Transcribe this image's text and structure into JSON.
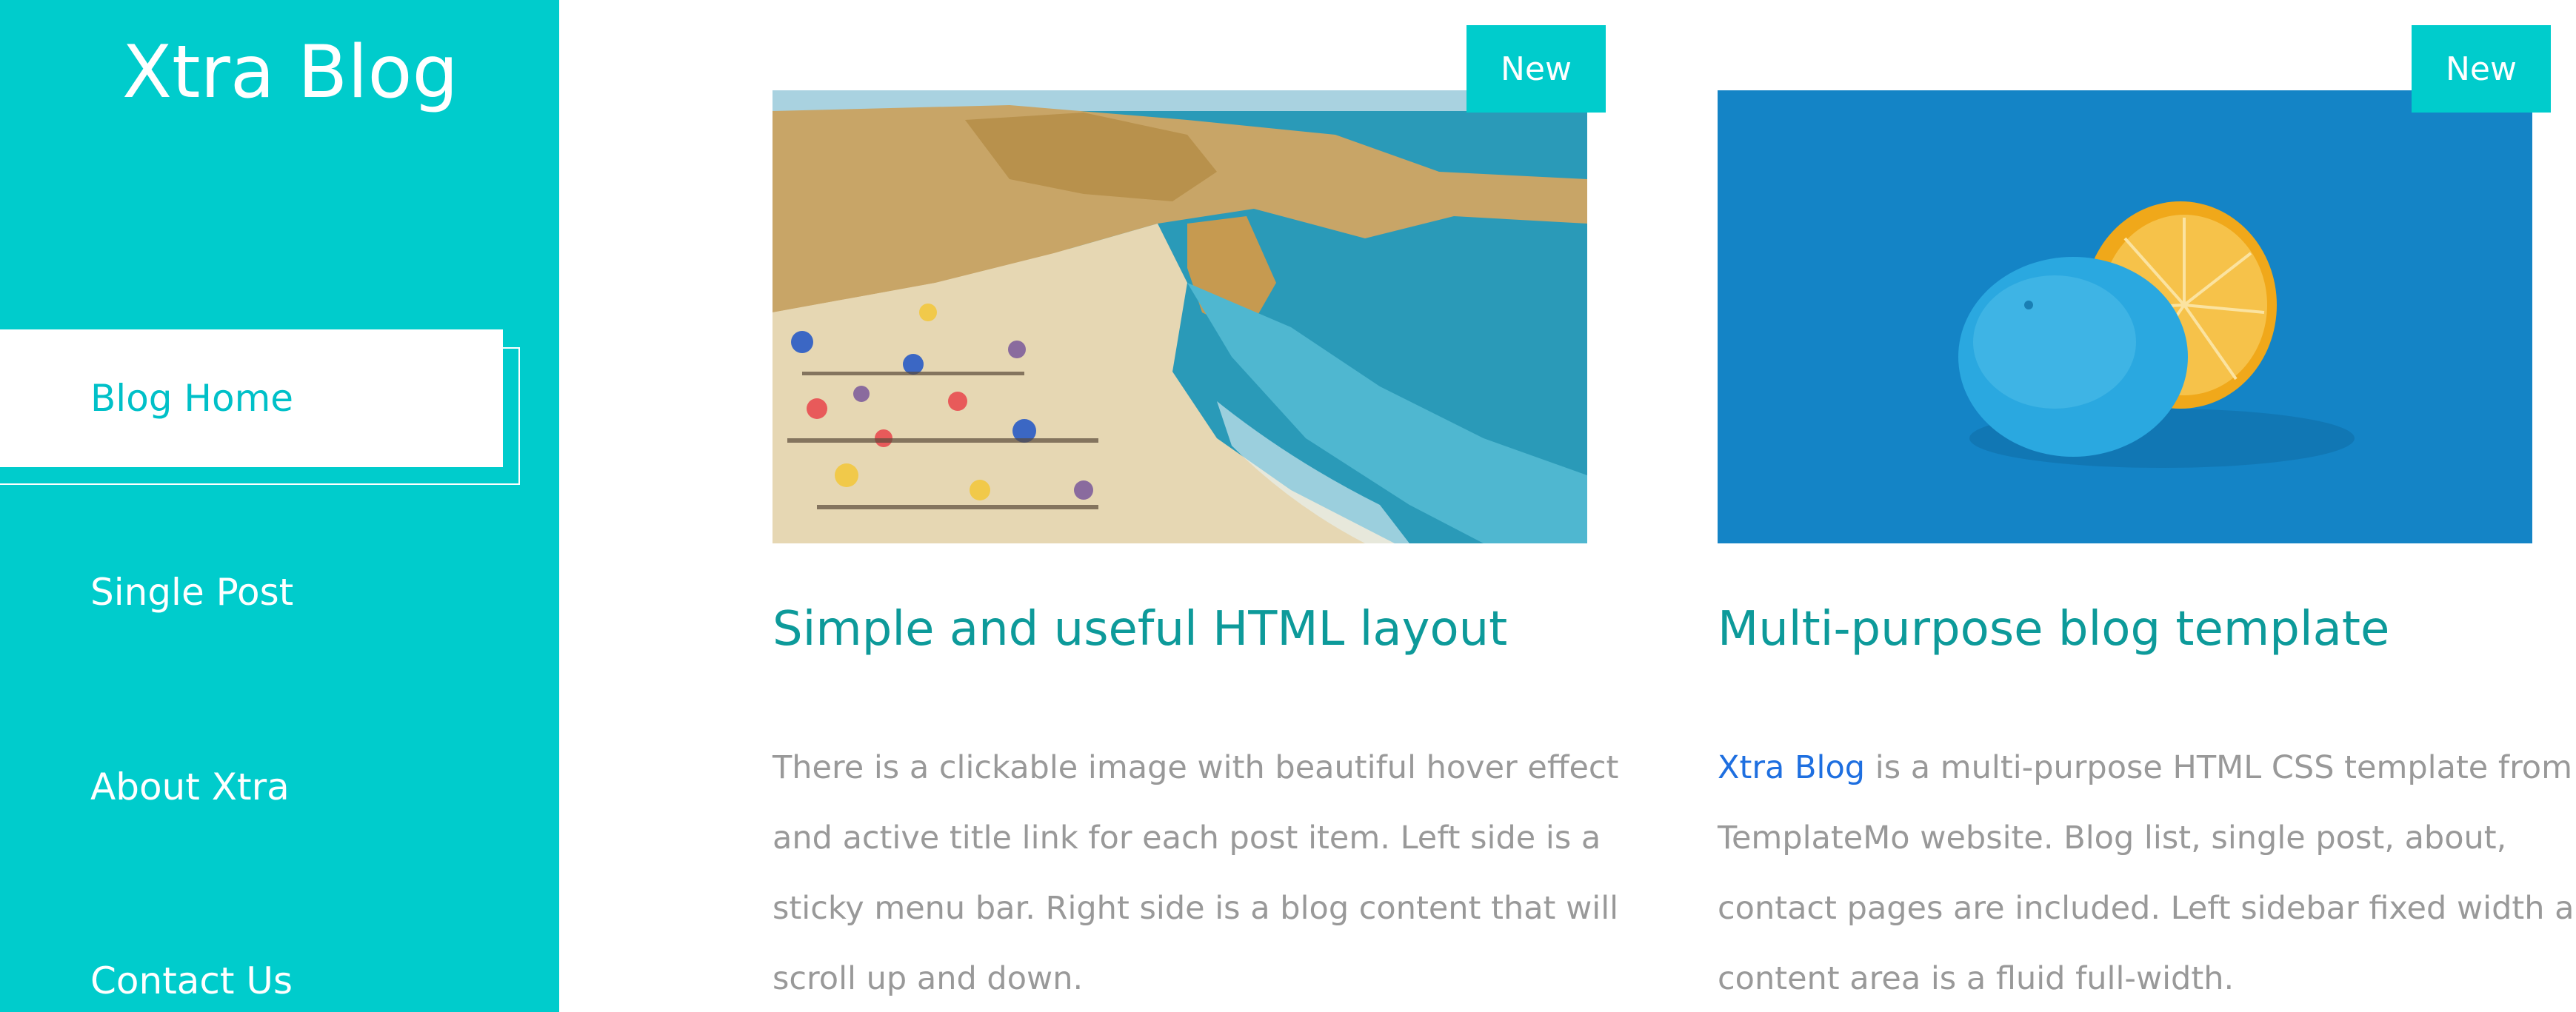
{
  "sidebar": {
    "brand": "Xtra Blog",
    "nav": [
      "Blog Home",
      "Single Post",
      "About Xtra",
      "Contact Us"
    ],
    "active_index": 0
  },
  "posts": [
    {
      "badge": "New",
      "title": "Simple and useful HTML layout",
      "image": "beach-cliffs-photo",
      "body_lines": [
        "There is a clickable image with beautiful hover effect",
        "and active title link for each post item. Left side is a",
        "sticky menu bar. Right side is a blog content that will",
        "scroll up and down."
      ]
    },
    {
      "badge": "New",
      "title": "Multi-purpose blog template",
      "image": "blue-orange-photo",
      "body_link": "Xtra Blog",
      "body_first_rest": " is a multi-purpose HTML CSS template from",
      "body_lines": [
        "TemplateMo website. Blog list, single post, about,",
        "contact pages are included. Left sidebar fixed width and",
        "content area is a fluid full-width."
      ]
    }
  ],
  "colors": {
    "accent": "#00cccc",
    "title": "#0d9a9a",
    "body_text": "#999999",
    "link": "#1e6fe0"
  }
}
